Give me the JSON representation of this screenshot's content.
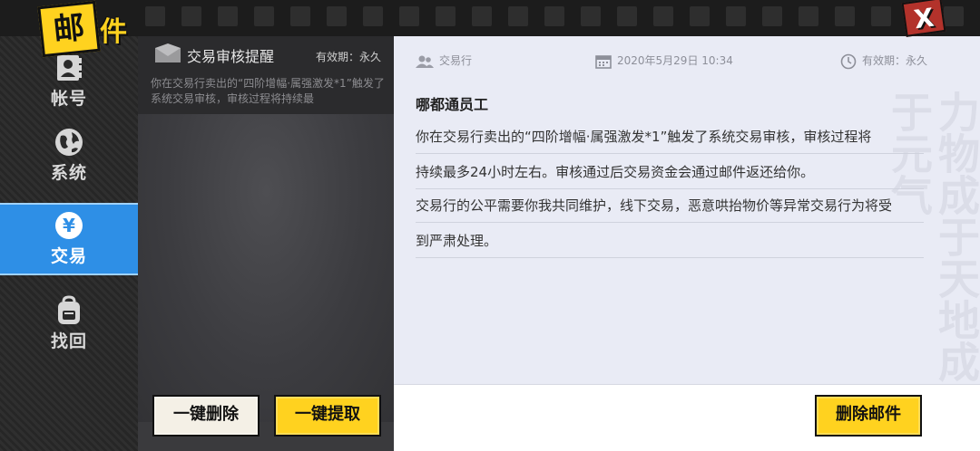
{
  "title": {
    "char1": "邮",
    "char2": "件"
  },
  "sidebar": {
    "items": [
      {
        "label": "帐号",
        "icon": "id-card-icon"
      },
      {
        "label": "系统",
        "icon": "globe-icon"
      },
      {
        "label": "交易",
        "icon": "yen-coin-icon",
        "active": true
      },
      {
        "label": "找回",
        "icon": "backpack-icon"
      }
    ]
  },
  "mail_list": {
    "items": [
      {
        "subject": "交易审核提醒",
        "expiry": "有效期：永久",
        "preview": "你在交易行卖出的“四阶增幅·属强激发*1”触发了系统交易审核，审核过程将持续最"
      }
    ],
    "delete_all_label": "一键删除",
    "claim_all_label": "一键提取"
  },
  "detail": {
    "sender": "交易行",
    "date": "2020年5月29日  10:34",
    "expiry": "有效期：永久",
    "recipient": "哪都通员工",
    "lines": [
      "你在交易行卖出的“四阶增幅·属强激发*1”触发了系统交易审核，审核过程将",
      "持续最多24小时左右。审核通过后交易资金会通过邮件返还给你。",
      "交易行的公平需要你我共同维护，线下交易，恶意哄抬物价等异常交易行为将受",
      "到严肃处理。"
    ],
    "delete_label": "删除邮件"
  },
  "close_label": "X",
  "colors": {
    "accent_yellow": "#ffd21f",
    "active_blue": "#2e8fe6",
    "close_red": "#b3322b"
  }
}
